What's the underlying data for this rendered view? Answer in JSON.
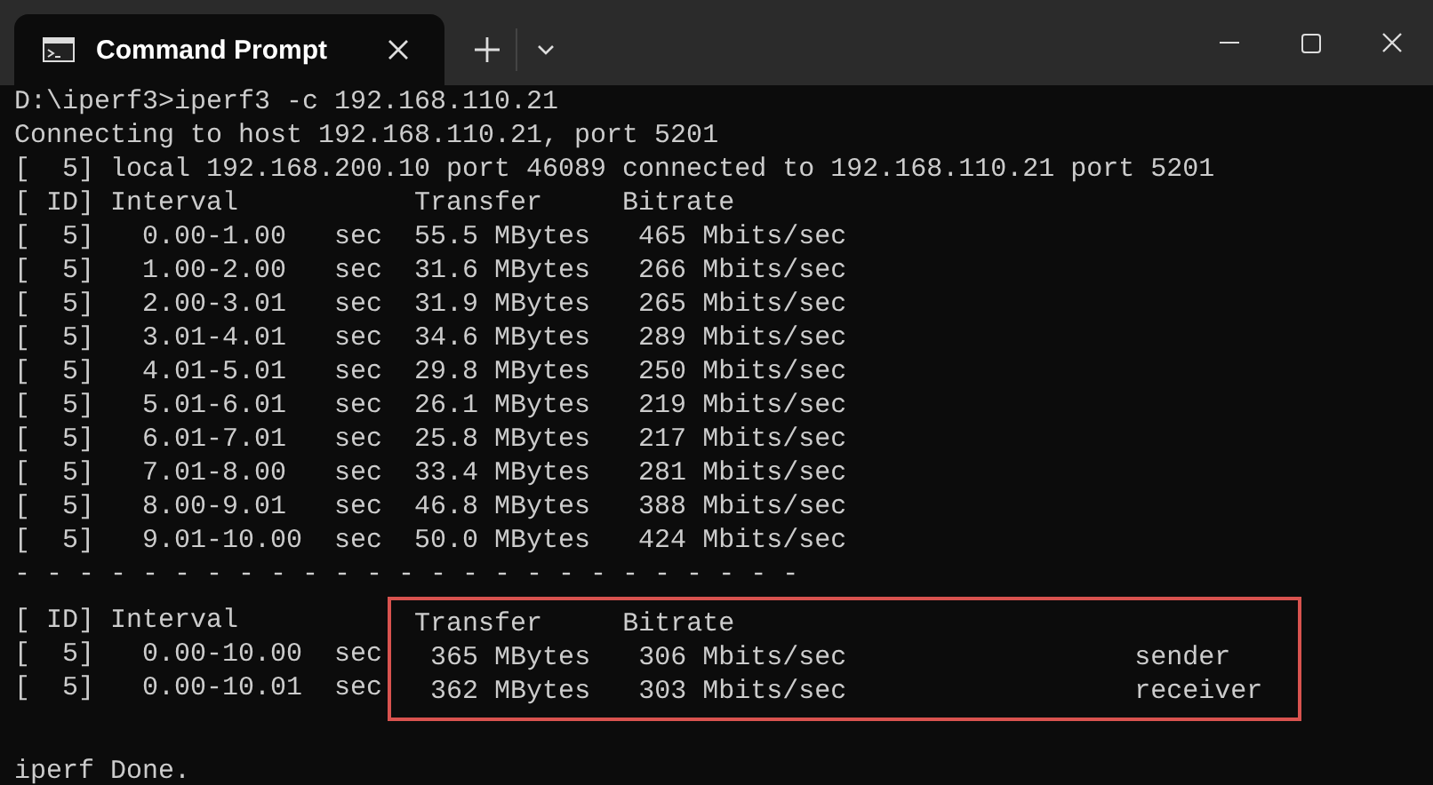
{
  "window": {
    "tab_title": "Command Prompt"
  },
  "terminal": {
    "lines": [
      "D:\\iperf3>iperf3 -c 192.168.110.21",
      "Connecting to host 192.168.110.21, port 5201",
      "[  5] local 192.168.200.10 port 46089 connected to 192.168.110.21 port 5201",
      "[ ID] Interval           Transfer     Bitrate",
      "[  5]   0.00-1.00   sec  55.5 MBytes   465 Mbits/sec",
      "[  5]   1.00-2.00   sec  31.6 MBytes   266 Mbits/sec",
      "[  5]   2.00-3.01   sec  31.9 MBytes   265 Mbits/sec",
      "[  5]   3.01-4.01   sec  34.6 MBytes   289 Mbits/sec",
      "[  5]   4.01-5.01   sec  29.8 MBytes   250 Mbits/sec",
      "[  5]   5.01-6.01   sec  26.1 MBytes   219 Mbits/sec",
      "[  5]   6.01-7.01   sec  25.8 MBytes   217 Mbits/sec",
      "[  5]   7.01-8.00   sec  33.4 MBytes   281 Mbits/sec",
      "[  5]   8.00-9.01   sec  46.8 MBytes   388 Mbits/sec",
      "[  5]   9.01-10.00  sec  50.0 MBytes   424 Mbits/sec",
      "- - - - - - - - - - - - - - - - - - - - - - - - -"
    ],
    "summary": {
      "highlighted": true,
      "rows": [
        {
          "left": "[ ID] Interval",
          "right": " Transfer     Bitrate"
        },
        {
          "left": "[  5]   0.00-10.00  sec",
          "right": "  365 MBytes   306 Mbits/sec                  sender"
        },
        {
          "left": "[  5]   0.00-10.01  sec",
          "right": "  362 MBytes   303 Mbits/sec                  receiver"
        }
      ]
    },
    "footer_lines": [
      "iperf Done."
    ]
  }
}
